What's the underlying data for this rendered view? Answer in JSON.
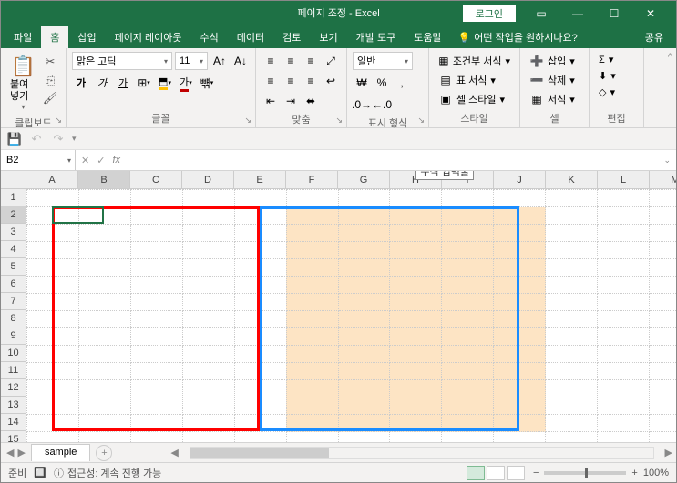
{
  "title": {
    "doc": "페이지 조정",
    "app": "Excel",
    "login": "로그인"
  },
  "tabs": {
    "file": "파일",
    "home": "홈",
    "insert": "삽입",
    "layout": "페이지 레이아웃",
    "formula": "수식",
    "data": "데이터",
    "review": "검토",
    "view": "보기",
    "dev": "개발 도구",
    "help": "도움말",
    "tellme": "어떤 작업을 원하시나요?",
    "share": "공유"
  },
  "ribbon": {
    "clipboard": {
      "label": "클립보드",
      "paste": "붙여넣기"
    },
    "font": {
      "label": "글꼴",
      "name": "맑은 고딕",
      "size": "11"
    },
    "align": {
      "label": "맞춤"
    },
    "number": {
      "label": "표시 형식",
      "format": "일반"
    },
    "styles": {
      "label": "스타일",
      "cond": "조건부 서식",
      "table": "표 서식",
      "cell": "셀 스타일"
    },
    "cells": {
      "label": "셀",
      "insert": "삽입",
      "delete": "삭제",
      "format": "서식"
    },
    "editing": {
      "label": "편집"
    }
  },
  "namebox": "B2",
  "tooltip": "수식 입력줄",
  "columns": [
    "A",
    "B",
    "C",
    "D",
    "E",
    "F",
    "G",
    "H",
    "I",
    "J",
    "K",
    "L",
    "M"
  ],
  "rows": [
    "1",
    "2",
    "3",
    "4",
    "5",
    "6",
    "7",
    "8",
    "9",
    "10",
    "11",
    "12",
    "13",
    "14",
    "15"
  ],
  "sheet_tab": "sample",
  "status": {
    "ready": "준비",
    "acc": "접근성: 계속 진행 가능",
    "zoom": "100%"
  }
}
